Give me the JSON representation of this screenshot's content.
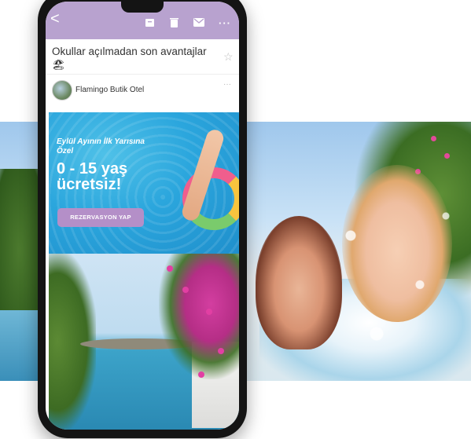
{
  "email": {
    "subject": "Okullar açılmadan son avantajlar 🏖",
    "sender": "Flamingo Butik Otel",
    "sender_more": "···"
  },
  "toolbar": {
    "back": "<",
    "more": "···"
  },
  "banner": {
    "line1": "Eylül Ayının İlk Yarısına Özel",
    "line2": "0 - 15 yaş ücretsiz!",
    "cta_label": "REZERVASYON YAP"
  },
  "colors": {
    "topbar": "#b8a2cf",
    "cta": "#b48fc8",
    "phone_frame": "#141414"
  },
  "icons": [
    "back-icon",
    "archive-icon",
    "trash-icon",
    "mail-icon",
    "more-icon",
    "star-icon"
  ]
}
